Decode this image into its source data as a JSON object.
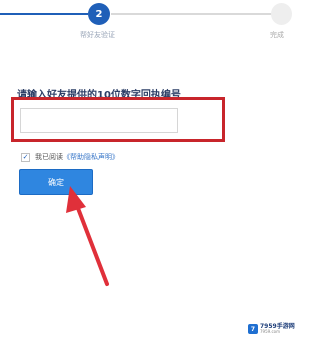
{
  "stepper": {
    "active_step_number": "2",
    "active_step_label": "帮好友验证",
    "next_step_label": "完成",
    "active_color": "#1f5fb8"
  },
  "form": {
    "prompt": "请输入好友提供的10位数字回执编号",
    "code_value": "",
    "code_placeholder": "",
    "agree_checked": true,
    "agree_text": "我已阅读",
    "privacy_link": "《帮助隐私声明》",
    "confirm_label": "确定"
  },
  "annotation": {
    "highlight_color": "#c8252b",
    "arrow_color": "#e0303a"
  },
  "watermark": {
    "logo_text": "7",
    "name": "7959手游网",
    "url": "7959.com"
  }
}
